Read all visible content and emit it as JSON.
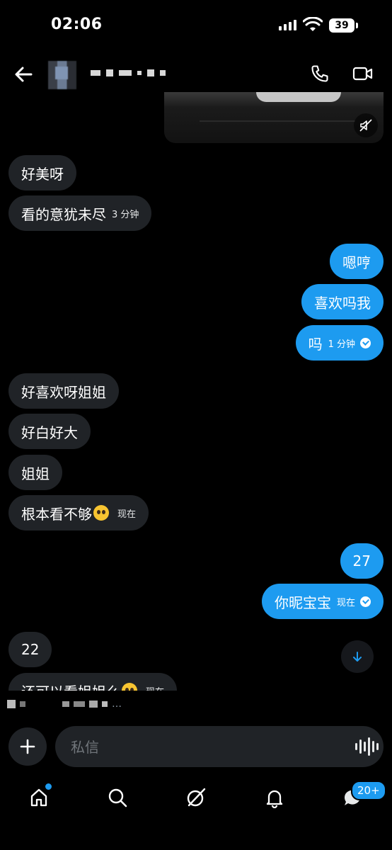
{
  "status_bar": {
    "time": "02:06",
    "battery": "39"
  },
  "composer": {
    "placeholder": "私信"
  },
  "tabbar": {
    "messages_badge": "20+"
  },
  "messages": [
    {
      "side": "in",
      "text": "好美呀"
    },
    {
      "side": "in",
      "text": "看的意犹未尽",
      "meta": "3 分钟"
    },
    {
      "side": "out",
      "text": "嗯哼"
    },
    {
      "side": "out",
      "text": "喜欢吗我"
    },
    {
      "side": "out",
      "text": "吗",
      "meta": "1 分钟"
    },
    {
      "side": "in",
      "text": "好喜欢呀姐姐"
    },
    {
      "side": "in",
      "text": "好白好大"
    },
    {
      "side": "in",
      "text": "姐姐"
    },
    {
      "side": "in",
      "text": "根本看不够",
      "meta": "现在"
    },
    {
      "side": "out",
      "text": "27"
    },
    {
      "side": "out",
      "text": "你昵宝宝",
      "meta": "现在"
    },
    {
      "side": "in",
      "text": "22"
    },
    {
      "side": "in",
      "text": "还可以看姐姐么",
      "meta": "现在"
    }
  ],
  "icons": {
    "back": "arrow-left-icon",
    "call": "phone-icon",
    "video": "video-camera-icon",
    "mute": "muted-speaker-icon",
    "scroll": "arrow-down-icon",
    "plus": "plus-icon",
    "voice": "waveform-icon",
    "home": "home-icon",
    "search": "search-icon",
    "grok": "grok-icon",
    "notifications": "bell-icon",
    "messages": "messages-icon"
  },
  "colors": {
    "accent": "#1d9bf0",
    "incoming_bubble": "#202327",
    "background": "#000000"
  }
}
